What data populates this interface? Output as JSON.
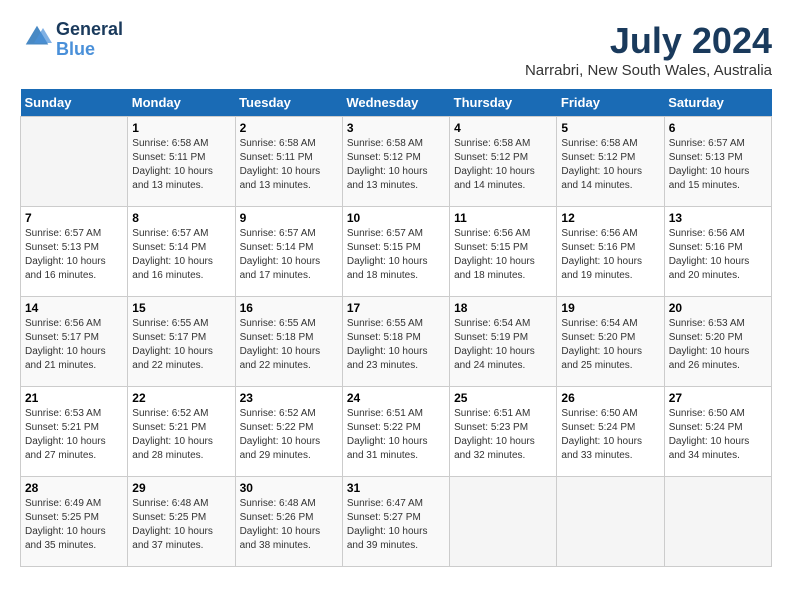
{
  "logo": {
    "line1": "General",
    "line2": "Blue"
  },
  "title": "July 2024",
  "location": "Narrabri, New South Wales, Australia",
  "days_of_week": [
    "Sunday",
    "Monday",
    "Tuesday",
    "Wednesday",
    "Thursday",
    "Friday",
    "Saturday"
  ],
  "weeks": [
    [
      {
        "day": "",
        "info": ""
      },
      {
        "day": "1",
        "info": "Sunrise: 6:58 AM\nSunset: 5:11 PM\nDaylight: 10 hours\nand 13 minutes."
      },
      {
        "day": "2",
        "info": "Sunrise: 6:58 AM\nSunset: 5:11 PM\nDaylight: 10 hours\nand 13 minutes."
      },
      {
        "day": "3",
        "info": "Sunrise: 6:58 AM\nSunset: 5:12 PM\nDaylight: 10 hours\nand 13 minutes."
      },
      {
        "day": "4",
        "info": "Sunrise: 6:58 AM\nSunset: 5:12 PM\nDaylight: 10 hours\nand 14 minutes."
      },
      {
        "day": "5",
        "info": "Sunrise: 6:58 AM\nSunset: 5:12 PM\nDaylight: 10 hours\nand 14 minutes."
      },
      {
        "day": "6",
        "info": "Sunrise: 6:57 AM\nSunset: 5:13 PM\nDaylight: 10 hours\nand 15 minutes."
      }
    ],
    [
      {
        "day": "7",
        "info": "Sunrise: 6:57 AM\nSunset: 5:13 PM\nDaylight: 10 hours\nand 16 minutes."
      },
      {
        "day": "8",
        "info": "Sunrise: 6:57 AM\nSunset: 5:14 PM\nDaylight: 10 hours\nand 16 minutes."
      },
      {
        "day": "9",
        "info": "Sunrise: 6:57 AM\nSunset: 5:14 PM\nDaylight: 10 hours\nand 17 minutes."
      },
      {
        "day": "10",
        "info": "Sunrise: 6:57 AM\nSunset: 5:15 PM\nDaylight: 10 hours\nand 18 minutes."
      },
      {
        "day": "11",
        "info": "Sunrise: 6:56 AM\nSunset: 5:15 PM\nDaylight: 10 hours\nand 18 minutes."
      },
      {
        "day": "12",
        "info": "Sunrise: 6:56 AM\nSunset: 5:16 PM\nDaylight: 10 hours\nand 19 minutes."
      },
      {
        "day": "13",
        "info": "Sunrise: 6:56 AM\nSunset: 5:16 PM\nDaylight: 10 hours\nand 20 minutes."
      }
    ],
    [
      {
        "day": "14",
        "info": "Sunrise: 6:56 AM\nSunset: 5:17 PM\nDaylight: 10 hours\nand 21 minutes."
      },
      {
        "day": "15",
        "info": "Sunrise: 6:55 AM\nSunset: 5:17 PM\nDaylight: 10 hours\nand 22 minutes."
      },
      {
        "day": "16",
        "info": "Sunrise: 6:55 AM\nSunset: 5:18 PM\nDaylight: 10 hours\nand 22 minutes."
      },
      {
        "day": "17",
        "info": "Sunrise: 6:55 AM\nSunset: 5:18 PM\nDaylight: 10 hours\nand 23 minutes."
      },
      {
        "day": "18",
        "info": "Sunrise: 6:54 AM\nSunset: 5:19 PM\nDaylight: 10 hours\nand 24 minutes."
      },
      {
        "day": "19",
        "info": "Sunrise: 6:54 AM\nSunset: 5:20 PM\nDaylight: 10 hours\nand 25 minutes."
      },
      {
        "day": "20",
        "info": "Sunrise: 6:53 AM\nSunset: 5:20 PM\nDaylight: 10 hours\nand 26 minutes."
      }
    ],
    [
      {
        "day": "21",
        "info": "Sunrise: 6:53 AM\nSunset: 5:21 PM\nDaylight: 10 hours\nand 27 minutes."
      },
      {
        "day": "22",
        "info": "Sunrise: 6:52 AM\nSunset: 5:21 PM\nDaylight: 10 hours\nand 28 minutes."
      },
      {
        "day": "23",
        "info": "Sunrise: 6:52 AM\nSunset: 5:22 PM\nDaylight: 10 hours\nand 29 minutes."
      },
      {
        "day": "24",
        "info": "Sunrise: 6:51 AM\nSunset: 5:22 PM\nDaylight: 10 hours\nand 31 minutes."
      },
      {
        "day": "25",
        "info": "Sunrise: 6:51 AM\nSunset: 5:23 PM\nDaylight: 10 hours\nand 32 minutes."
      },
      {
        "day": "26",
        "info": "Sunrise: 6:50 AM\nSunset: 5:24 PM\nDaylight: 10 hours\nand 33 minutes."
      },
      {
        "day": "27",
        "info": "Sunrise: 6:50 AM\nSunset: 5:24 PM\nDaylight: 10 hours\nand 34 minutes."
      }
    ],
    [
      {
        "day": "28",
        "info": "Sunrise: 6:49 AM\nSunset: 5:25 PM\nDaylight: 10 hours\nand 35 minutes."
      },
      {
        "day": "29",
        "info": "Sunrise: 6:48 AM\nSunset: 5:25 PM\nDaylight: 10 hours\nand 37 minutes."
      },
      {
        "day": "30",
        "info": "Sunrise: 6:48 AM\nSunset: 5:26 PM\nDaylight: 10 hours\nand 38 minutes."
      },
      {
        "day": "31",
        "info": "Sunrise: 6:47 AM\nSunset: 5:27 PM\nDaylight: 10 hours\nand 39 minutes."
      },
      {
        "day": "",
        "info": ""
      },
      {
        "day": "",
        "info": ""
      },
      {
        "day": "",
        "info": ""
      }
    ]
  ]
}
